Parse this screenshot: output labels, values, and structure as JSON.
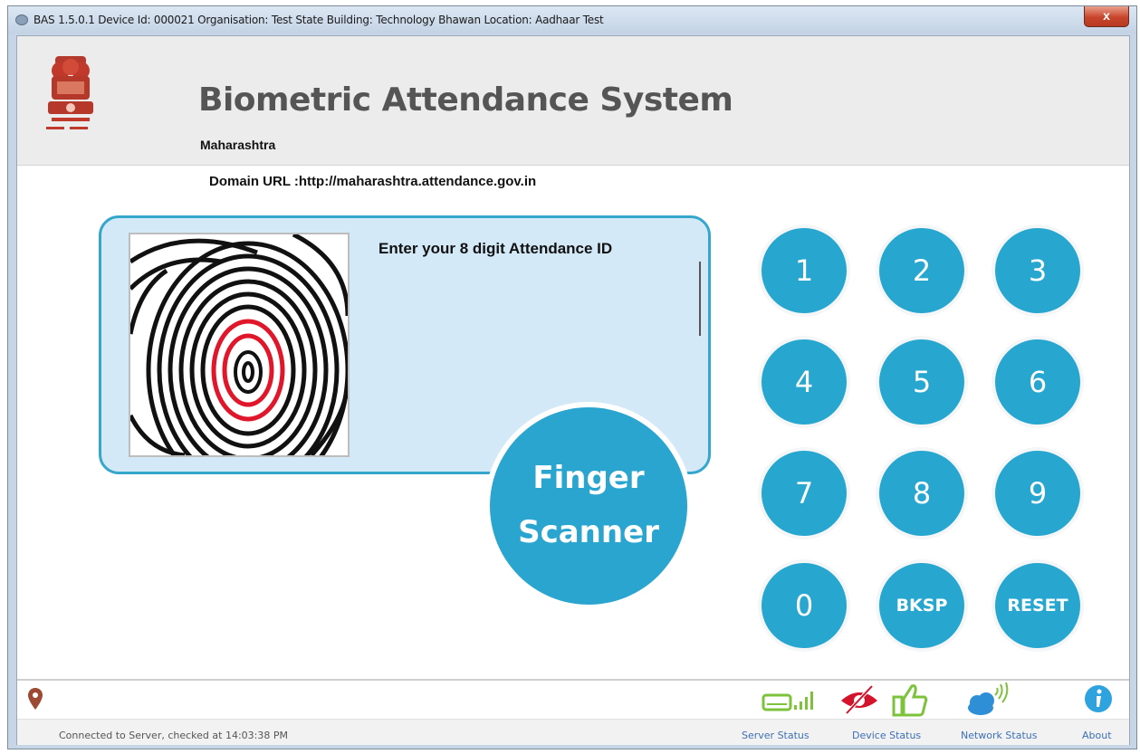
{
  "window": {
    "title": "BAS 1.5.0.1 Device Id: 000021 Organisation: Test State Building: Technology Bhawan Location: Aadhaar Test",
    "close_label": "x"
  },
  "header": {
    "title": "Biometric Attendance System",
    "state": "Maharashtra",
    "domain_url": "Domain URL :http://maharashtra.attendance.gov.in"
  },
  "entry": {
    "prompt": "Enter your 8 digit Attendance ID",
    "value": ""
  },
  "scanner": {
    "line1": "Finger",
    "line2": "Scanner"
  },
  "keypad": {
    "keys": [
      "1",
      "2",
      "3",
      "4",
      "5",
      "6",
      "7",
      "8",
      "9",
      "0",
      "BKSP",
      "RESET"
    ]
  },
  "footer": {
    "connection_status": "Connected to Server, checked at 14:03:38 PM",
    "server_status_label": "Server Status",
    "device_status_label": "Device Status",
    "network_status_label": "Network Status",
    "about_label": "About"
  },
  "colors": {
    "accent": "#27a7cf",
    "panel_bg": "#d4e9f8",
    "fingerprint_core": "#e0162b",
    "server_icon": "#7cc33b",
    "device_icon": "#d4142a",
    "thumb_icon": "#7cc33b",
    "network_icon": "#2f8fd6",
    "location_icon": "#9c4a33"
  }
}
